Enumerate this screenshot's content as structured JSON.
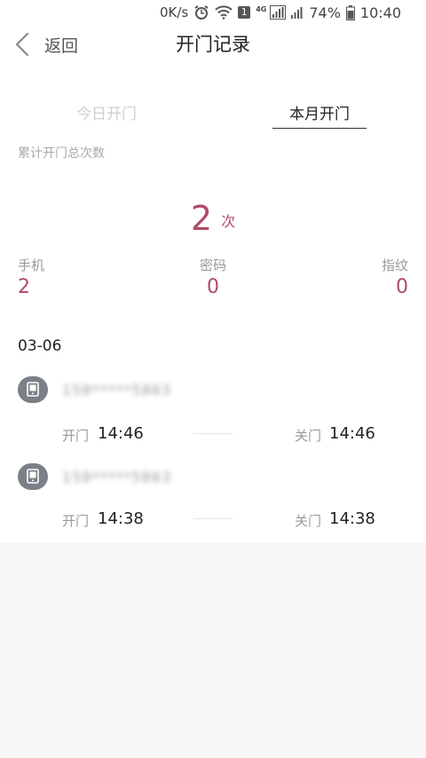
{
  "statusbar": {
    "net_speed": "0K/s",
    "sim_badge": "1",
    "network_type": "4G",
    "battery": "74%",
    "time": "10:40"
  },
  "header": {
    "back_label": "返回",
    "title": "开门记录"
  },
  "tabs": {
    "today": "今日开门",
    "month": "本月开门",
    "active": "month"
  },
  "summary": {
    "label": "累计开门总次数",
    "count": "2",
    "unit": "次",
    "accent_color": "#b04a66"
  },
  "stats": [
    {
      "label": "手机",
      "value": "2"
    },
    {
      "label": "密码",
      "value": "0"
    },
    {
      "label": "指纹",
      "value": "0"
    }
  ],
  "records": {
    "date": "03-06",
    "items": [
      {
        "phone": "158*****5863",
        "open_label": "开门",
        "open_time": "14:46",
        "close_label": "关门",
        "close_time": "14:46"
      },
      {
        "phone": "158*****5863",
        "open_label": "开门",
        "open_time": "14:38",
        "close_label": "关门",
        "close_time": "14:38"
      }
    ]
  }
}
